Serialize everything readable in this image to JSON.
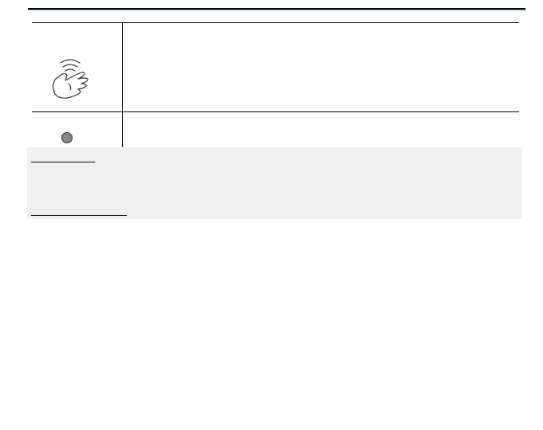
{
  "table": {
    "rows": [
      {
        "icon": "hand-proximity-icon",
        "description": ""
      },
      {
        "icon": "indicator-light-icon",
        "description": ""
      }
    ]
  },
  "note": {
    "text": ""
  }
}
